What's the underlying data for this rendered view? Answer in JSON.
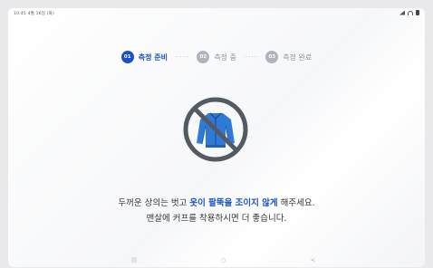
{
  "status_bar": {
    "time_date": "10:45 4월 16일 (화)"
  },
  "stepper": {
    "steps": [
      {
        "num": "01",
        "label": "측정 준비"
      },
      {
        "num": "02",
        "label": "측정 중"
      },
      {
        "num": "03",
        "label": "측정 완료"
      }
    ],
    "separator": "······"
  },
  "message": {
    "line1_before": "두꺼운 상의는 벗고 ",
    "line1_highlight": "옷이 팔뚝을 조이지 않게",
    "line1_after": " 해주세요.",
    "line2": "맨살에 커프를 착용하시면 더 좋습니다."
  },
  "colors": {
    "accent": "#1a52c4",
    "inactive": "#aeb4bd",
    "jacket": "#2f7ad6",
    "prohibition": "#545a63"
  },
  "icons": {
    "illustration": "no-jacket-icon"
  }
}
